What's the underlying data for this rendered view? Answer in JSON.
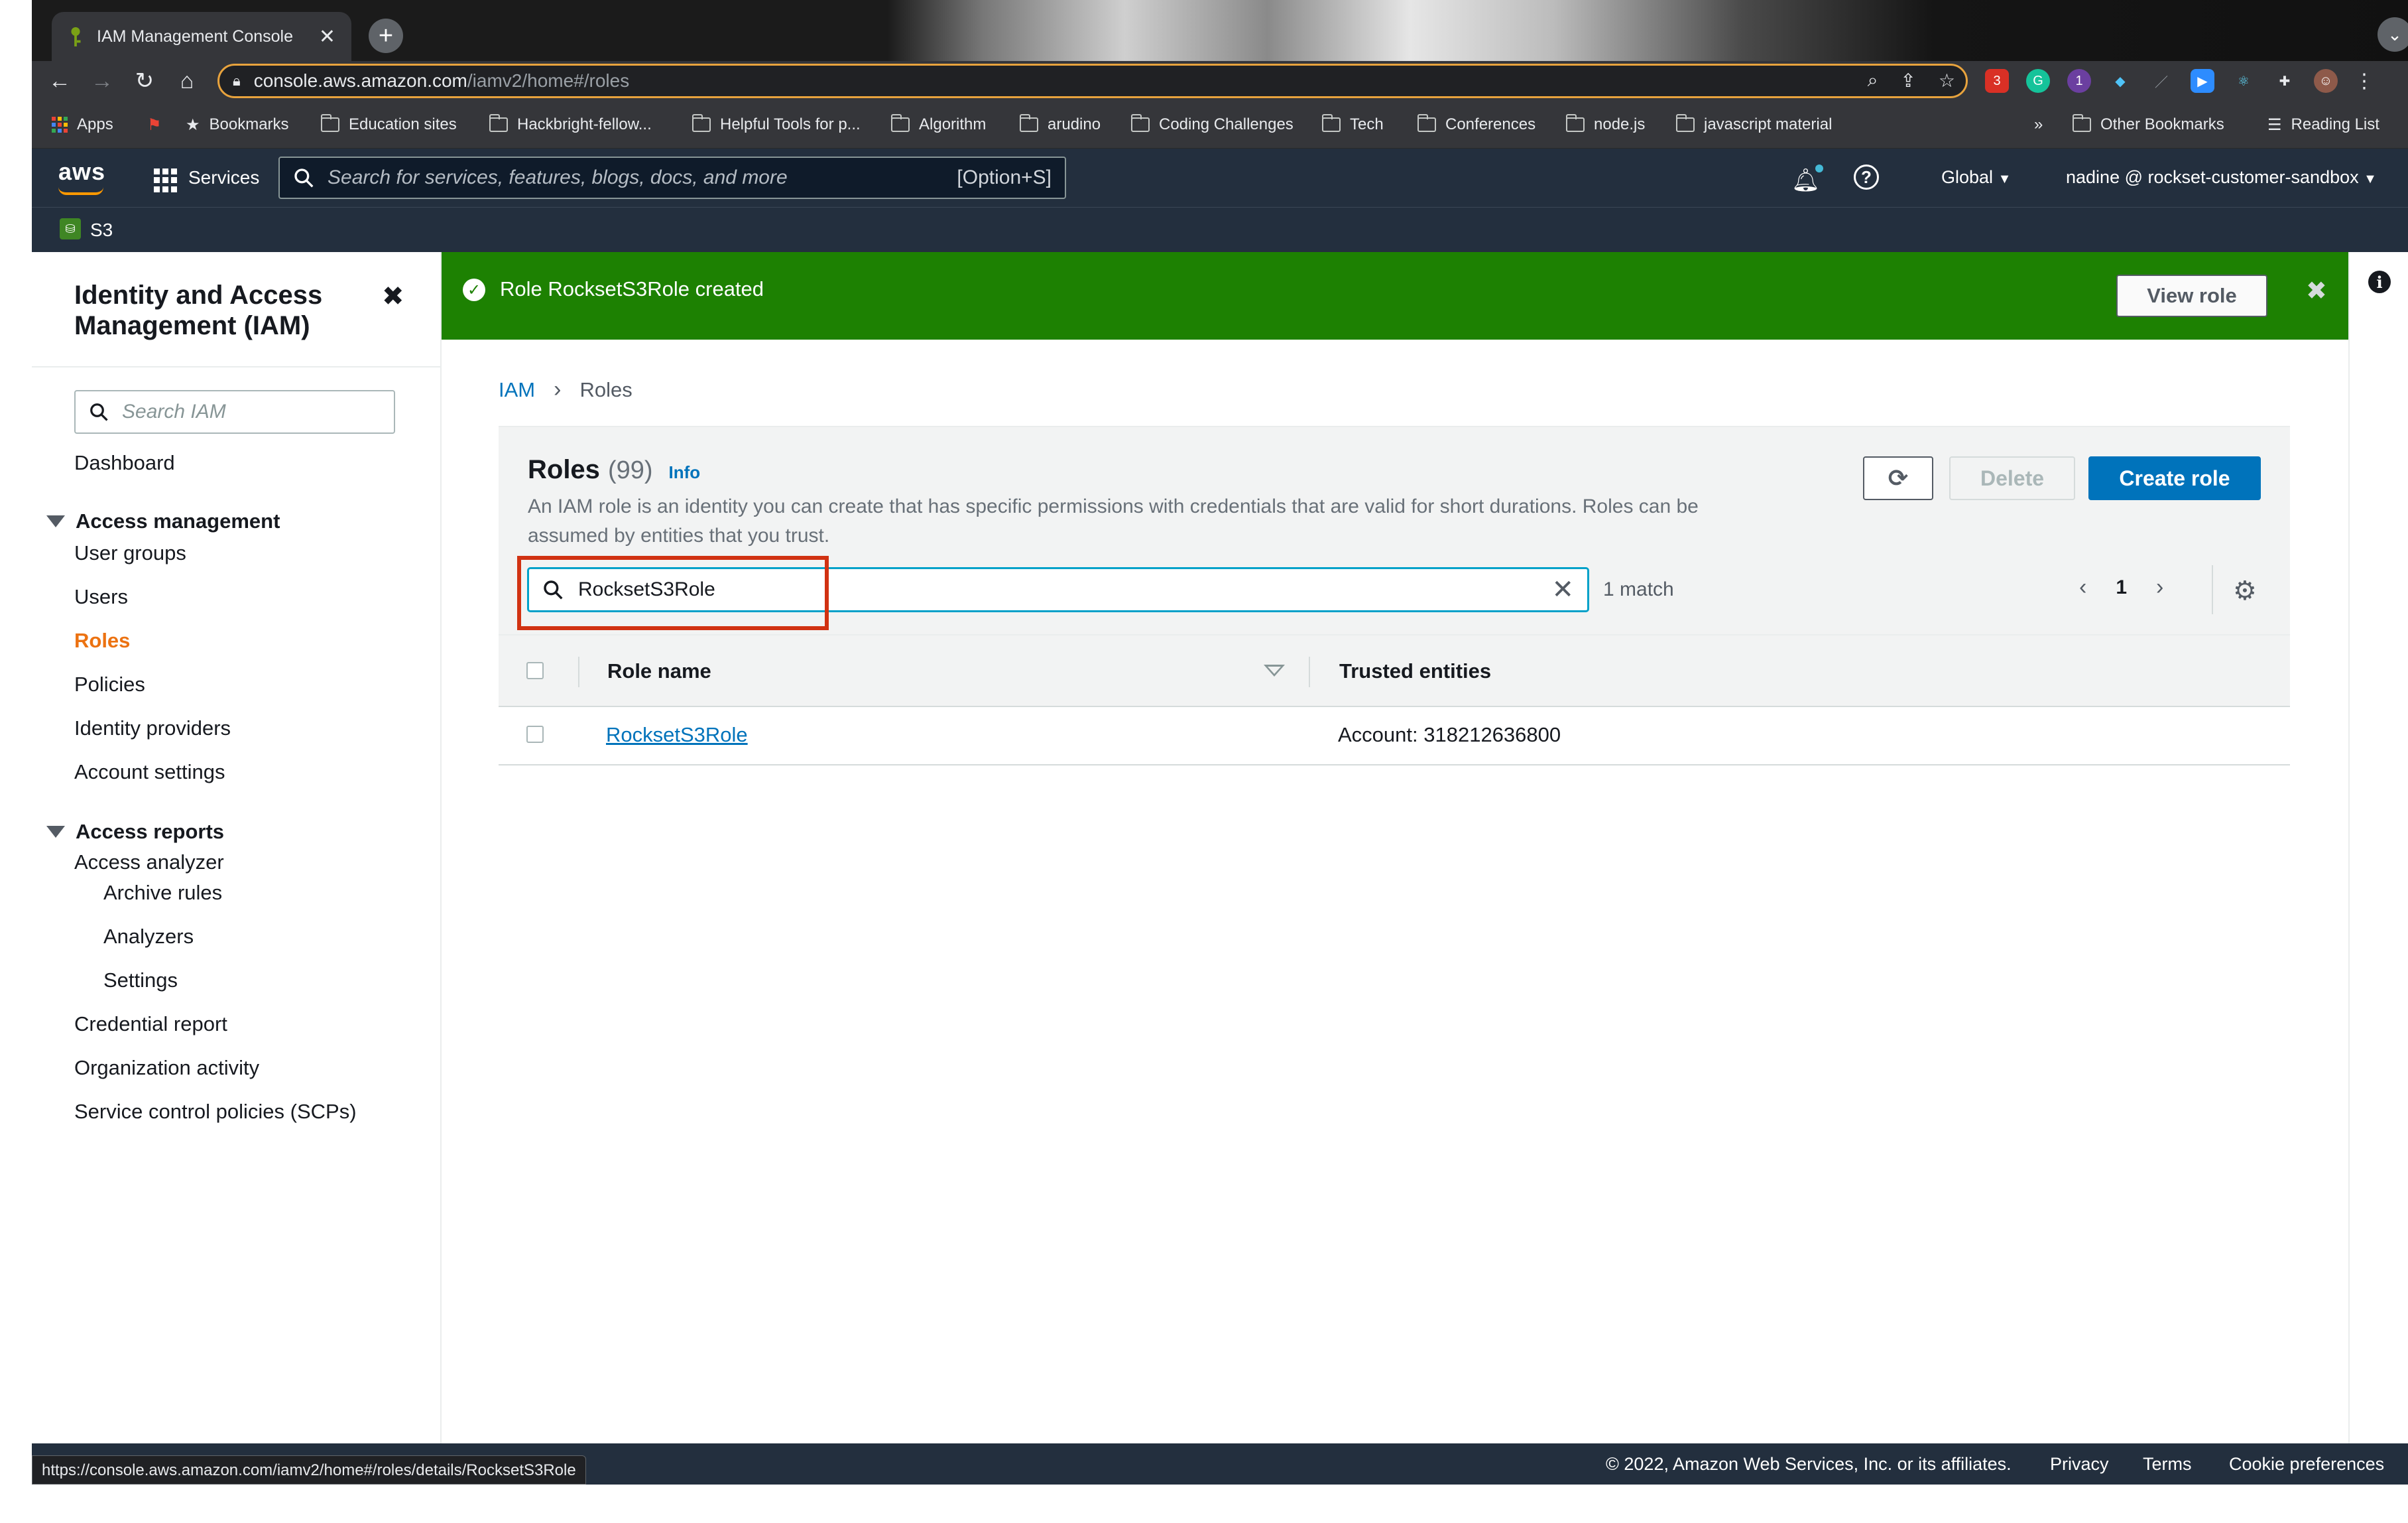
{
  "browser": {
    "tab_title": "IAM Management Console",
    "url_host": "console.aws.amazon.com",
    "url_path": "/iamv2/home#/roles",
    "bookmarks": [
      "Apps",
      "Bookmarks",
      "Education sites",
      "Hackbright-fellow...",
      "Helpful Tools for p...",
      "Algorithm",
      "arudino",
      "Coding Challenges",
      "Tech",
      "Conferences",
      "node.js",
      "javascript material"
    ],
    "bookmarks_overflow": "»",
    "other_bookmarks": "Other Bookmarks",
    "reading_list": "Reading List",
    "extension_badges": [
      "3",
      "1"
    ],
    "status_url": "https://console.aws.amazon.com/iamv2/home#/roles/details/RocksetS3Role"
  },
  "aws_header": {
    "logo": "aws",
    "services_label": "Services",
    "search_placeholder": "Search for services, features, blogs, docs, and more",
    "search_shortcut": "[Option+S]",
    "region": "Global",
    "account": "nadine @ rockset-customer-sandbox",
    "pinned_service": "S3"
  },
  "sidebar": {
    "title": "Identity and Access Management (IAM)",
    "search_placeholder": "Search IAM",
    "dashboard": "Dashboard",
    "access_management": {
      "label": "Access management",
      "items": [
        "User groups",
        "Users",
        "Roles",
        "Policies",
        "Identity providers",
        "Account settings"
      ]
    },
    "access_reports": {
      "label": "Access reports",
      "items": [
        "Access analyzer",
        "Archive rules",
        "Analyzers",
        "Settings",
        "Credential report",
        "Organization activity",
        "Service control policies (SCPs)"
      ]
    },
    "active_item": "Roles"
  },
  "flash": {
    "message": "Role RocksetS3Role created",
    "view_button": "View role"
  },
  "breadcrumb": {
    "root": "IAM",
    "current": "Roles"
  },
  "roles_panel": {
    "title": "Roles",
    "count": "(99)",
    "info": "Info",
    "description": "An IAM role is an identity you can create that has specific permissions with credentials that are valid for short durations. Roles can be assumed by entities that you trust.",
    "delete_label": "Delete",
    "create_label": "Create role",
    "filter_value": "RocksetS3Role",
    "match_text": "1 match",
    "page_number": "1",
    "columns": [
      "Role name",
      "Trusted entities"
    ],
    "rows": [
      {
        "role_name": "RocksetS3Role",
        "trusted": "Account: 318212636800"
      }
    ]
  },
  "footer": {
    "copyright": "© 2022, Amazon Web Services, Inc. or its affiliates.",
    "privacy": "Privacy",
    "terms": "Terms",
    "cookies": "Cookie preferences"
  },
  "colors": {
    "aws_navy": "#232f3e",
    "aws_orange": "#ff9900",
    "success_green": "#1d8102",
    "link_blue": "#0073bb",
    "highlight_red": "#d13212",
    "active_nav": "#ec7211"
  }
}
